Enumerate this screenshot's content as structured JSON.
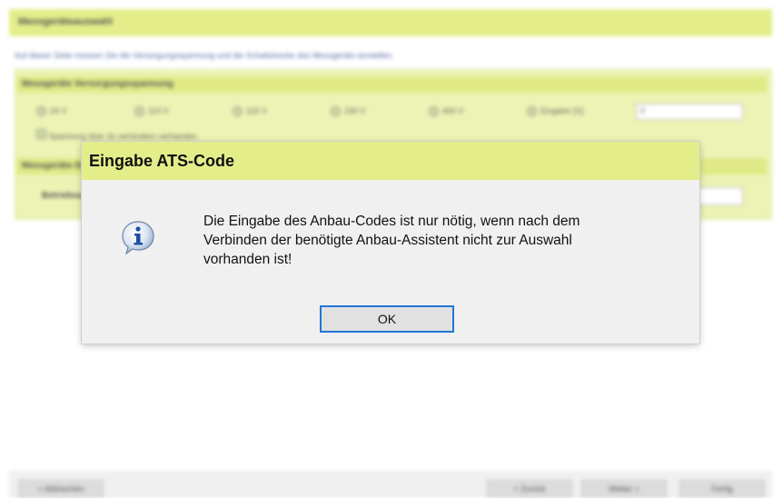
{
  "background_page": {
    "title": "Messgeräteauswahl",
    "description": "Auf dieser Seite müssen Sie die Versorgungsspannung und die Schaltstrecke des Messgeräts einstellen.",
    "voltage_section": {
      "header": "Messgeräte Versorgungsspannung",
      "options": [
        "24 V",
        "110 V",
        "115 V",
        "230 V",
        "400 V",
        "Eingabe [V]:"
      ],
      "custom_value": "0",
      "checkbox_label": "Spannung über 3s verhindern verhanden"
    },
    "second_section": {
      "header": "Messgeräte-Schaltstrecke",
      "row_label": "Betriebsart"
    },
    "footer": {
      "left_button": "< Abbrechen",
      "back_button": "< Zurück",
      "next_button": "Weiter >",
      "finish_button": "Fertig"
    }
  },
  "dialog": {
    "title": "Eingabe ATS-Code",
    "message_lines": [
      "Die Eingabe des Anbau-Codes ist nur nötig, wenn nach dem",
      "Verbinden der benötigte Anbau-Assistent nicht zur Auswahl",
      "vorhanden ist!"
    ],
    "ok_label": "OK",
    "icon": "info-icon"
  },
  "colors": {
    "accent_yellow": "#e3ee8a",
    "dialog_bg": "#f0f0f0",
    "button_focus": "#1e78d7"
  }
}
